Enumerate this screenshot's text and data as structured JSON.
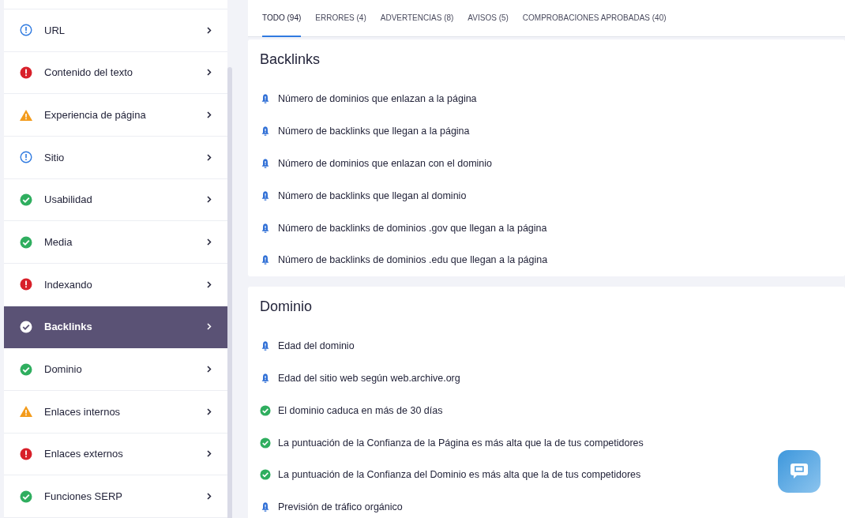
{
  "sidebar": {
    "items": [
      {
        "label": "URL",
        "kind": "info",
        "selected": false
      },
      {
        "label": "Contenido del texto",
        "kind": "error",
        "selected": false
      },
      {
        "label": "Experiencia de página",
        "kind": "warning",
        "selected": false
      },
      {
        "label": "Sitio",
        "kind": "info",
        "selected": false
      },
      {
        "label": "Usabilidad",
        "kind": "ok",
        "selected": false
      },
      {
        "label": "Media",
        "kind": "ok",
        "selected": false
      },
      {
        "label": "Indexando",
        "kind": "error",
        "selected": false
      },
      {
        "label": "Backlinks",
        "kind": "ok",
        "selected": true
      },
      {
        "label": "Dominio",
        "kind": "ok",
        "selected": false
      },
      {
        "label": "Enlaces internos",
        "kind": "warning",
        "selected": false
      },
      {
        "label": "Enlaces externos",
        "kind": "error",
        "selected": false
      },
      {
        "label": "Funciones SERP",
        "kind": "ok",
        "selected": false
      }
    ]
  },
  "tabs": [
    {
      "label": "TODO (94)",
      "selected": true
    },
    {
      "label": "ERRORES (4)",
      "selected": false
    },
    {
      "label": "ADVERTENCIAS (8)",
      "selected": false
    },
    {
      "label": "AVISOS (5)",
      "selected": false
    },
    {
      "label": "COMPROBACIONES APROBADAS (40)",
      "selected": false
    }
  ],
  "sections": [
    {
      "title": "Backlinks",
      "checks": [
        {
          "text": "Número de dominios que enlazan a la página",
          "kind": "notice"
        },
        {
          "text": "Número de backlinks que llegan a la página",
          "kind": "notice"
        },
        {
          "text": "Número de dominios que enlazan con el dominio",
          "kind": "notice"
        },
        {
          "text": "Número de backlinks que llegan al dominio",
          "kind": "notice"
        },
        {
          "text": "Número de backlinks de dominios .gov que llegan a la página",
          "kind": "notice"
        },
        {
          "text": "Número de backlinks de dominios .edu que llegan a la página",
          "kind": "notice"
        }
      ]
    },
    {
      "title": "Dominio",
      "checks": [
        {
          "text": "Edad del dominio",
          "kind": "notice"
        },
        {
          "text": "Edad del sitio web según web.archive.org",
          "kind": "notice"
        },
        {
          "text": "El dominio caduca en más de 30 días",
          "kind": "ok"
        },
        {
          "text": "La puntuación de la Confianza de la Página es más alta que la de tus competidores",
          "kind": "ok"
        },
        {
          "text": "La puntuación de la Confianza del Dominio es más alta que la de tus competidores",
          "kind": "ok"
        },
        {
          "text": "Previsión de tráfico orgánico",
          "kind": "notice"
        }
      ]
    }
  ]
}
